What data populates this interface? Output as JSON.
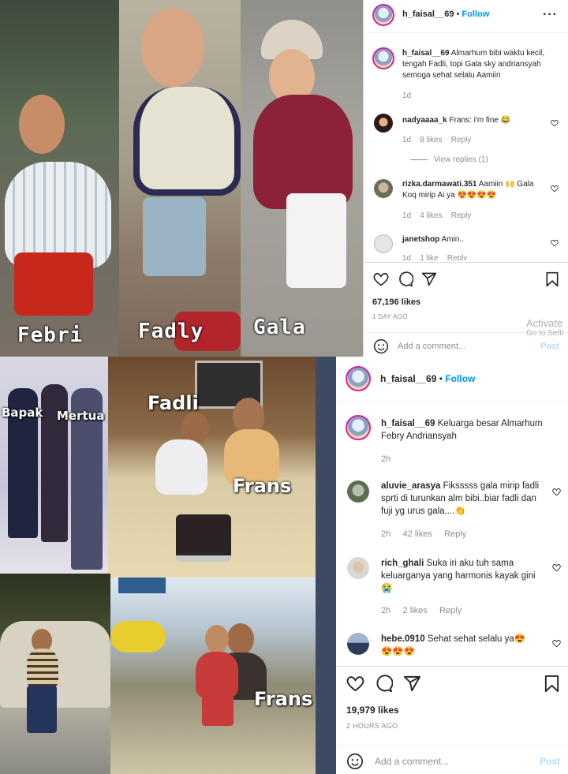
{
  "top_post": {
    "captions": [
      "Febri",
      "Fadly",
      "Gala"
    ],
    "header": {
      "username": "h_faisal__69",
      "dot": "•",
      "follow": "Follow"
    },
    "caption": {
      "username": "h_faisal__69",
      "text": "Almarhum bibi waktu kecil, tengah Fadli, topi Gala sky andriansyah semoga sehat selalu Aamiin",
      "time": "1d"
    },
    "comments": [
      {
        "username": "nadyaaaa_k",
        "text": "Frans: i'm fine 😂",
        "time": "1d",
        "likes": "8 likes",
        "reply": "Reply",
        "view_replies": "View replies (1)"
      },
      {
        "username": "rizka.darmawati.351",
        "text": "Aamiin 🙌 Gala Koq mirip Ai ya 😍😍😍😍",
        "time": "1d",
        "likes": "4 likes",
        "reply": "Reply"
      },
      {
        "username": "janetshop",
        "text": "Amin..",
        "time": "1d",
        "likes": "1 like",
        "reply": "Reply"
      }
    ],
    "likes": "67,196 likes",
    "date": "1 DAY AGO",
    "add_comment": "Add a comment...",
    "post": "Post",
    "watermark": [
      "Activate",
      "Go to Setti"
    ]
  },
  "bottom_post": {
    "captions": {
      "bapak": "Bapak",
      "mertua": "Mertua",
      "fadli": "Fadli",
      "frans1": "Frans",
      "frans2": "Frans"
    },
    "header": {
      "username": "h_faisal__69",
      "dot": "•",
      "follow": "Follow"
    },
    "caption": {
      "username": "h_faisal__69",
      "text": "Keluarga besar Almarhum Febry Andriansyah",
      "time": "2h"
    },
    "comments": [
      {
        "username": "aluvie_arasya",
        "text": "Fiksssss gala mirip fadli sprti di turunkan alm bibi..biar fadli dan fuji yg urus gala....👏",
        "time": "2h",
        "likes": "42 likes",
        "reply": "Reply"
      },
      {
        "username": "rich_ghali",
        "text": "Suka iri aku tuh sama keluarganya yang harmonis kayak gini 😭",
        "time": "2h",
        "likes": "2 likes",
        "reply": "Reply"
      },
      {
        "username": "hebe.0910",
        "text": "Sehat sehat selalu ya😍 😍😍😍",
        "time": "",
        "likes": "",
        "reply": ""
      }
    ],
    "likes": "19,979 likes",
    "date": "2 HOURS AGO",
    "add_comment": "Add a comment...",
    "post": "Post"
  }
}
